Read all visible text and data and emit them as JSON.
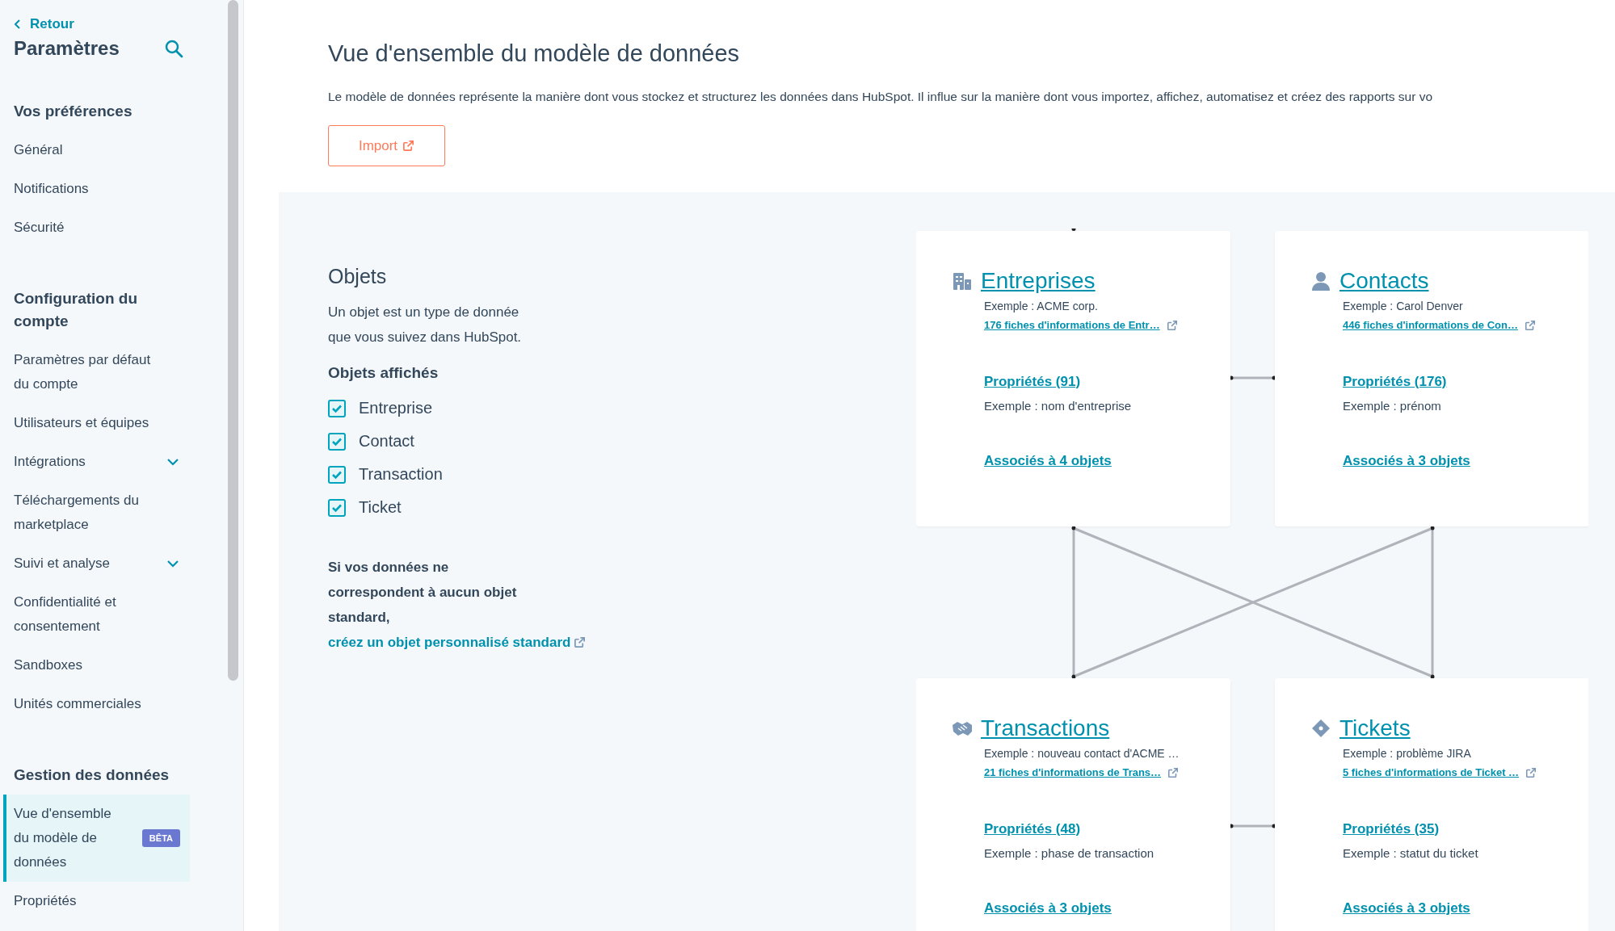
{
  "sidebar": {
    "back_link": "Retour",
    "title": "Paramètres",
    "sections": [
      {
        "heading": "Vos préférences",
        "items": [
          {
            "label": "Général",
            "selected": false
          },
          {
            "label": "Notifications",
            "selected": false
          },
          {
            "label": "Sécurité",
            "selected": false
          }
        ]
      },
      {
        "heading": "Configuration du compte",
        "items": [
          {
            "label": "Paramètres par défaut du compte",
            "selected": false
          },
          {
            "label": "Utilisateurs et équipes",
            "selected": false
          },
          {
            "label": "Intégrations",
            "selected": false,
            "expanded": false
          },
          {
            "label": "Téléchargements du marketplace",
            "selected": false
          },
          {
            "label": "Suivi et analyse",
            "selected": false,
            "expanded": false
          },
          {
            "label": "Confidentialité et consentement",
            "selected": false
          },
          {
            "label": "Sandboxes",
            "selected": false
          },
          {
            "label": "Unités commerciales",
            "selected": false
          }
        ]
      },
      {
        "heading": "Gestion des données",
        "items": [
          {
            "label": "Vue d'ensemble du modèle de données",
            "selected": true,
            "badge": "BÊTA"
          },
          {
            "label": "Propriétés",
            "selected": false
          }
        ]
      }
    ]
  },
  "header": {
    "title": "Vue d'ensemble du modèle de données",
    "description": "Le modèle de données représente la manière dont vous stockez et structurez les données dans HubSpot. Il influe sur la manière dont vous importez, affichez, automatisez et créez des rapports sur vo",
    "import_button": "Import"
  },
  "objects_panel": {
    "title": "Objets",
    "description": "Un objet est un type de donnée que vous suivez dans HubSpot.",
    "shown_heading": "Objets affichés",
    "checkboxes": [
      {
        "label": "Entreprise",
        "checked": true
      },
      {
        "label": "Contact",
        "checked": true
      },
      {
        "label": "Transaction",
        "checked": true
      },
      {
        "label": "Ticket",
        "checked": true
      }
    ],
    "note": "Si vos données ne correspondent à aucun objet standard, ",
    "note_link": "créez un objet personnalisé standard"
  },
  "diagram": {
    "cards": [
      {
        "kind": "company",
        "title": "Entreprises",
        "example": "Exemple : ACME corp.",
        "records_link": "176 fiches d'informations de Entr…",
        "properties_link": "Propriétés (91)",
        "properties_example": "Exemple : nom d'entreprise",
        "associations_link": "Associés à 4 objets"
      },
      {
        "kind": "contact",
        "title": "Contacts",
        "example": "Exemple : Carol Denver",
        "records_link": "446 fiches d'informations de Con…",
        "properties_link": "Propriétés (176)",
        "properties_example": "Exemple : prénom",
        "associations_link": "Associés à 3 objets"
      },
      {
        "kind": "deal",
        "title": "Transactions",
        "example": "Exemple : nouveau contact d'ACME …",
        "records_link": "21 fiches d'informations de Trans…",
        "properties_link": "Propriétés (48)",
        "properties_example": "Exemple : phase de transaction",
        "associations_link": "Associés à 3 objets"
      },
      {
        "kind": "ticket",
        "title": "Tickets",
        "example": "Exemple : problème JIRA",
        "records_link": "5 fiches d'informations de Ticket …",
        "properties_link": "Propriétés (35)",
        "properties_example": "Exemple : statut du ticket",
        "associations_link": "Associés à 3 objets"
      }
    ]
  }
}
